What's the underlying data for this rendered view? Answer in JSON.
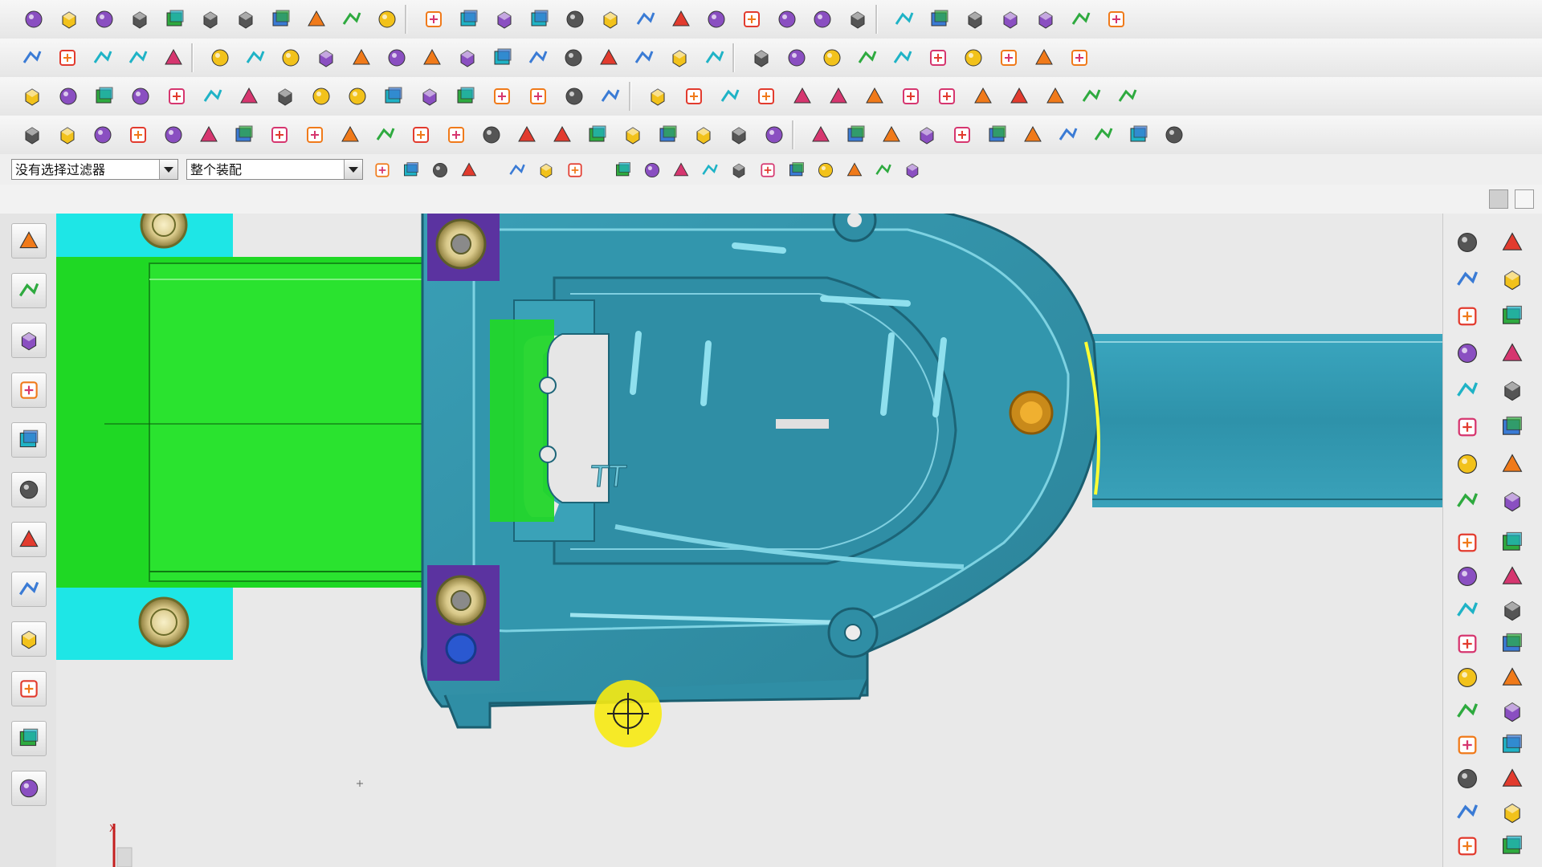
{
  "filter_bar": {
    "selection_filter_value": "没有选择过滤器",
    "assembly_scope_value": "整个装配"
  },
  "toolbars": {
    "row1_icons": [
      "new-file-icon",
      "open-icon",
      "shield-icon",
      "cylinder-icon",
      "box-icon",
      "sphere-icon",
      "torus-icon",
      "sketch-icon",
      "extrude-icon",
      "revolve-icon",
      "face-icon",
      "pattern-icon",
      "boolean-icon",
      "hole-icon",
      "shell-icon",
      "blend-icon",
      "chamfer-icon",
      "draft-icon",
      "rib-icon",
      "surface-icon",
      "mesh-icon",
      "sweep-icon",
      "loft-icon",
      "offset-icon",
      "trim-icon",
      "extend-icon",
      "sew-icon",
      "analysis-icon",
      "measure-icon",
      "curve-icon",
      "spline-icon"
    ],
    "row2_icons": [
      "grid-icon",
      "layer-icon",
      "triangle-icon",
      "section-icon",
      "stack-icon",
      "edit-body-icon",
      "sync-icon",
      "replace-icon",
      "move-face-icon",
      "resize-icon",
      "measure-distance-icon",
      "text-icon",
      "table-icon",
      "matrix-icon",
      "material-icon",
      "lines-icon",
      "frame-icon",
      "angle-icon",
      "clock-icon",
      "play-back-icon",
      "hourglass-icon",
      "datum-icon",
      "datum-axis-icon",
      "datum-plane-icon",
      "csys-icon",
      "point-icon",
      "mirror-icon",
      "trim-body-icon",
      "split-icon",
      "thicken-icon"
    ],
    "row3_icons": [
      "solid-icon",
      "diamond-icon",
      "block-icon",
      "array-icon",
      "assembly-icon",
      "color-icon",
      "fit-icon",
      "line-icon",
      "circle-icon",
      "hatch-icon",
      "crosshair-icon",
      "layers-icon",
      "parallelogram-icon",
      "arrow-icon",
      "node-icon",
      "check-icon",
      "delete-icon",
      "folder-icon",
      "person-icon",
      "component-icon",
      "move-icon",
      "window-icon",
      "slash-icon",
      "constraint-icon",
      "rotate-icon",
      "align-icon",
      "explode-icon",
      "grid-pattern-icon",
      "route-icon",
      "joint-icon",
      "undo-icon"
    ],
    "row4_icons": [
      "mold-wizard-icon",
      "core-icon",
      "cavity-icon",
      "pin-icon",
      "cube-icon",
      "wire-icon",
      "parting-icon",
      "sheet-icon",
      "dark-block-icon",
      "slider-icon",
      "text-a-icon",
      "cylinder-part-icon",
      "runner-icon",
      "ejector-icon",
      "cooling-icon",
      "insert-icon",
      "electrode-icon",
      "lifter-icon",
      "standard-part-icon",
      "gate-icon",
      "mold-base-icon",
      "drill-icon",
      "sprue-icon",
      "red-disc-icon",
      "half-disc-icon",
      "red-circle-icon",
      "ring-icon",
      "bolt-icon",
      "screw-icon",
      "stack-plate-icon",
      "flag-icon",
      "pencil-icon",
      "column-icon"
    ],
    "filter_row_icons": [
      "select-all-icon",
      "snap-icon",
      "undo-icon",
      "view-icon",
      "move-icon",
      "rotate-icon",
      "box-select-icon",
      "grid-snap-icon",
      "end-point-icon",
      "mid-point-icon",
      "arc-icon",
      "intersection-icon",
      "center-icon",
      "quadrant-icon",
      "tangent-icon",
      "existing-point-icon",
      "point-on-curve-icon",
      "cube-3d-icon"
    ]
  },
  "left_nav": [
    "assembly-navigator-icon",
    "constraint-navigator-icon",
    "part-navigator-icon",
    "reuse-library-icon",
    "hd3d-icon",
    "history-icon",
    "system-materials-icon",
    "palette-icon",
    "process-studio-icon",
    "roles-icon",
    "visualization-icon",
    "specification-icon"
  ],
  "right_palette": [
    "mold-design-validation-icon",
    "parting-tools-icon",
    "mold-trim-icon",
    "insert-pocket-icon",
    "sub-insert-icon",
    "electrode-library-icon",
    "standard-parts-icon",
    "ejector-pin-icon",
    "gate-library-icon",
    "cooling-channel-icon",
    "runner-icon",
    "slider-lifter-icon",
    "bill-of-materials-icon",
    "drawing-icon",
    "casting-icon",
    "mold-cost-icon"
  ],
  "viewport": {
    "axis_label": "X",
    "colors": {
      "background": "#e9e9e9",
      "part_teal": "#2f8fa8",
      "part_teal_light": "#45a9bf",
      "core_green": "#22d62a",
      "plate_cyan": "#1ee6e6",
      "insert_purple": "#6a3aa6",
      "highlight_yellow": "#ffff33"
    }
  }
}
